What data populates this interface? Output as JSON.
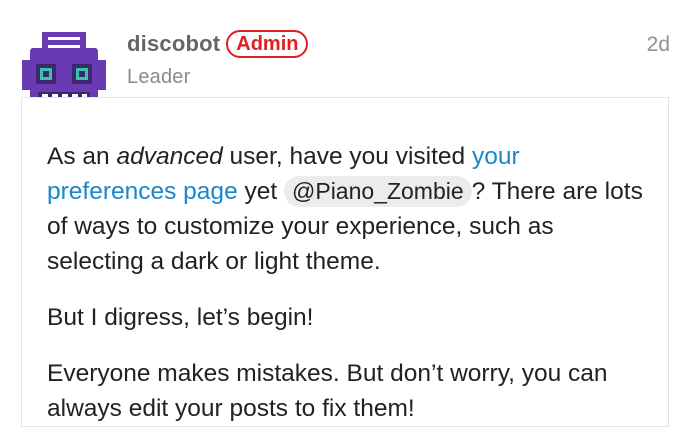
{
  "post": {
    "username": "discobot",
    "badge": "Admin",
    "user_title": "Leader",
    "time": "2d"
  },
  "body": {
    "p1_start": "As an ",
    "p1_em": "advanced",
    "p1_mid": " user, have you visited ",
    "p1_link": "your preferences page",
    "p1_yet": " yet ",
    "p1_mention": "@Piano_Zombie",
    "p1_end": "? There are lots of ways to customize your experience, such as selecting a dark or light theme.",
    "p2": "But I digress, let’s begin!",
    "p3": "Everyone makes mistakes. But don’t worry, you can always edit your posts to fix them!"
  },
  "colors": {
    "avatar_purple": "#6a3ab2",
    "avatar_dark": "#3b2870",
    "avatar_eye": "#36c5a9",
    "badge_red": "#e02020",
    "link_blue": "#1a87c9"
  }
}
